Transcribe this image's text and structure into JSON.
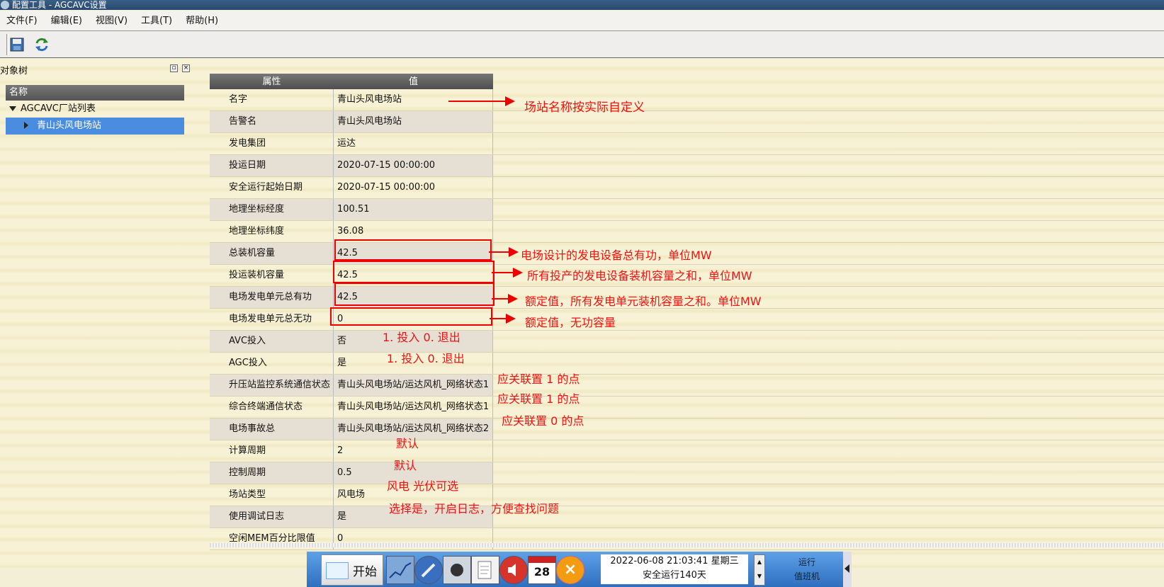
{
  "window": {
    "title": "配置工具 - AGCAVC设置"
  },
  "menu": [
    "文件(F)",
    "编辑(E)",
    "视图(V)",
    "工具(T)",
    "帮助(H)"
  ],
  "toolbar": {
    "icons": [
      "save-icon",
      "refresh-icon"
    ]
  },
  "tree": {
    "panel_title": "对象树",
    "column_header": "名称",
    "root": "AGCAVC厂站列表",
    "selected": "青山头风电场站"
  },
  "grid": {
    "headers": [
      "属性",
      "值"
    ],
    "rows": [
      {
        "name": "名字",
        "value": "青山头风电场站"
      },
      {
        "name": "告警名",
        "value": "青山头风电场站"
      },
      {
        "name": "发电集团",
        "value": "运达"
      },
      {
        "name": "投运日期",
        "value": "2020-07-15 00:00:00"
      },
      {
        "name": "安全运行起始日期",
        "value": "2020-07-15 00:00:00"
      },
      {
        "name": "地理坐标经度",
        "value": "100.51"
      },
      {
        "name": "地理坐标纬度",
        "value": "36.08"
      },
      {
        "name": "总装机容量",
        "value": "42.5"
      },
      {
        "name": "投运装机容量",
        "value": "42.5"
      },
      {
        "name": "电场发电单元总有功",
        "value": "42.5"
      },
      {
        "name": "电场发电单元总无功",
        "value": "0"
      },
      {
        "name": "AVC投入",
        "value": "否"
      },
      {
        "name": "AGC投入",
        "value": "是"
      },
      {
        "name": "升压站监控系统通信状态",
        "value": "青山头风电场站/运达风机_网络状态1"
      },
      {
        "name": "综合终端通信状态",
        "value": "青山头风电场站/运达风机_网络状态1"
      },
      {
        "name": "电场事故总",
        "value": "青山头风电场站/运达风机_网络状态2"
      },
      {
        "name": "计算周期",
        "value": "2"
      },
      {
        "name": "控制周期",
        "value": "0.5"
      },
      {
        "name": "场站类型",
        "value": "风电场"
      },
      {
        "name": "使用调试日志",
        "value": "是"
      },
      {
        "name": "空闲MEM百分比限值",
        "value": "0"
      }
    ]
  },
  "annotations": {
    "a1": "场站名称按实际自定义",
    "a2": "电场设计的发电设备总有功，单位MW",
    "a3": "所有投产的发电设备装机容量之和，单位MW",
    "a4": "额定值，所有发电单元装机容量之和。单位MW",
    "a5": "额定值，无功容量",
    "a6": "1. 投入   0. 退出",
    "a7": "1. 投入   0. 退出",
    "a8": "应关联置 1 的点",
    "a9": "应关联置 1 的点",
    "a10": "应关联置 0 的点",
    "a11": "默认",
    "a12": "默认",
    "a13": "风电   光伏可选",
    "a14": "选择是，开启日志，方便查找问题"
  },
  "taskbar": {
    "start": "开始",
    "datetime": "2022-06-08 21:03:41 星期三",
    "uptime": "安全运行140天",
    "status1": "运行",
    "status2": "值班机",
    "icons": [
      "chart-icon",
      "tools-icon",
      "orb-icon",
      "notepad-icon",
      "speaker-icon",
      "calendar-icon",
      "close-circle-icon"
    ],
    "calendar_day": "28"
  },
  "colors": {
    "annotation": "#e11111",
    "selection": "#4a8de0",
    "taskbar": "#3b7fd0"
  }
}
